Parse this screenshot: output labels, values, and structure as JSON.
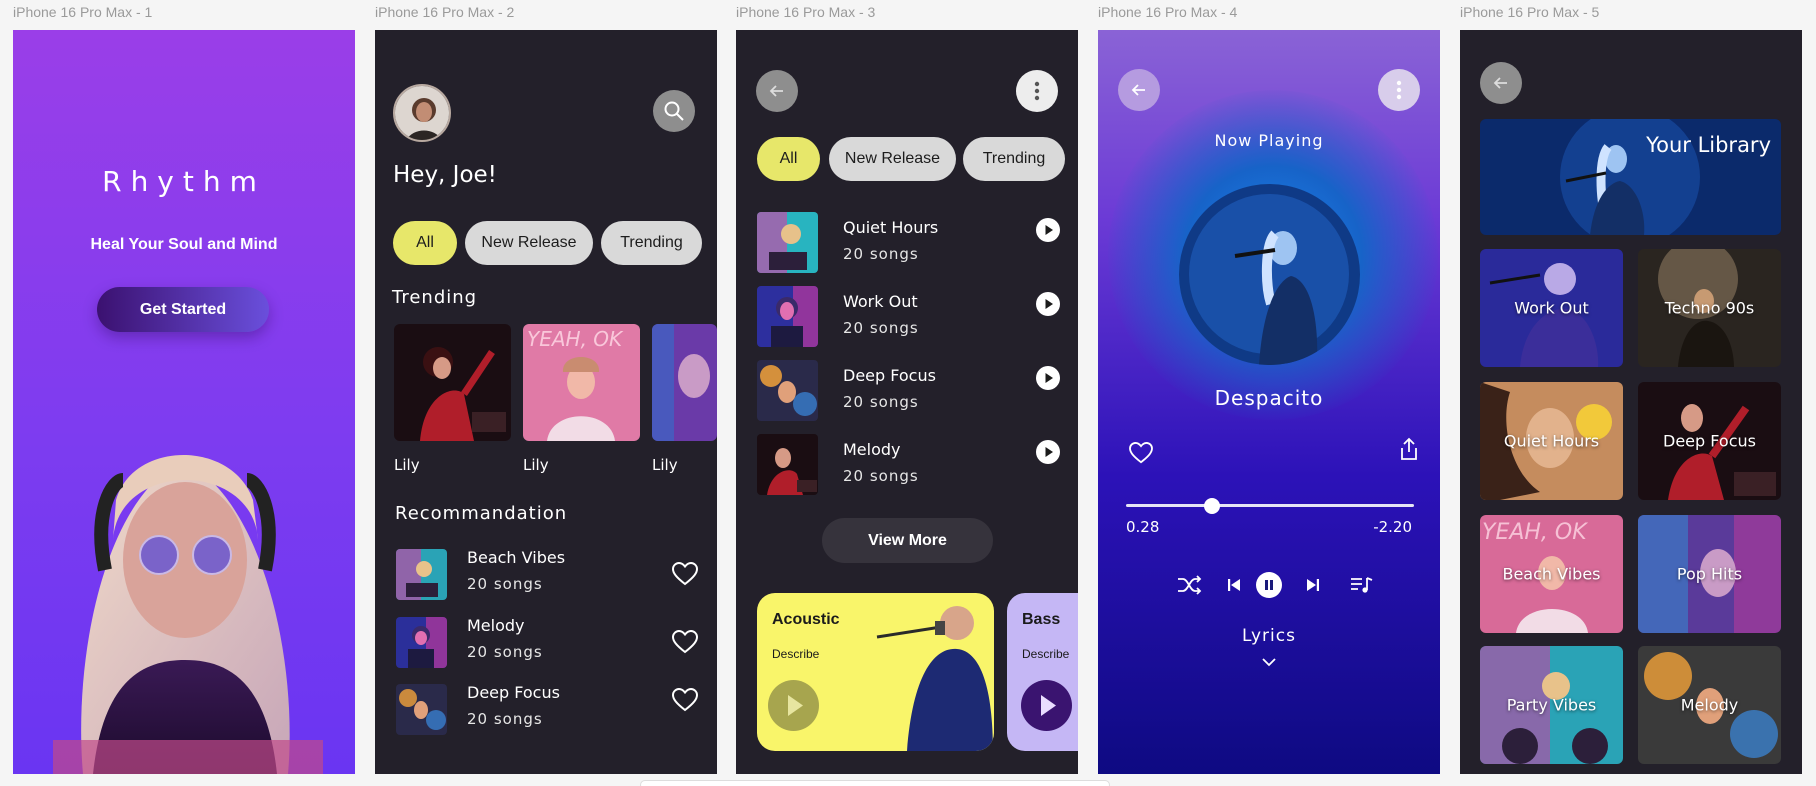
{
  "frames": {
    "f1": "iPhone 16 Pro Max - 1",
    "f2": "iPhone 16 Pro Max - 2",
    "f3": "iPhone 16 Pro Max - 3",
    "f4": "iPhone 16 Pro Max - 4",
    "f5": "iPhone 16 Pro Max - 5"
  },
  "splash": {
    "brand": "Rhythm",
    "tagline": "Heal Your Soul and Mind",
    "cta": "Get Started"
  },
  "home": {
    "greeting": "Hey, Joe!",
    "chips": [
      "All",
      "New Release",
      "Trending"
    ],
    "trending_title": "Trending",
    "trending": [
      {
        "name": "Lily"
      },
      {
        "name": "Lily"
      },
      {
        "name": "Lily"
      }
    ],
    "recommendation_title": "Recommandation",
    "recommendations": [
      {
        "title": "Beach Vibes",
        "sub": "20 songs"
      },
      {
        "title": "Melody",
        "sub": "20 songs"
      },
      {
        "title": "Deep Focus",
        "sub": "20 songs"
      }
    ]
  },
  "browse": {
    "chips": [
      "All",
      "New Release",
      "Trending"
    ],
    "playlists": [
      {
        "title": "Quiet Hours",
        "sub": "20 songs"
      },
      {
        "title": "Work Out",
        "sub": "20 songs"
      },
      {
        "title": "Deep Focus",
        "sub": "20 songs"
      },
      {
        "title": "Melody",
        "sub": "20 songs"
      }
    ],
    "view_more": "View More",
    "genres": [
      {
        "title": "Acoustic",
        "sub": "Describe",
        "color": "#f9f56a"
      },
      {
        "title": "Bass",
        "sub": "Describe",
        "color": "#c5b7f5"
      }
    ]
  },
  "player": {
    "now_playing": "Now Playing",
    "song": "Despacito",
    "elapsed": "0.28",
    "remaining": "-2.20",
    "progress": 0.3,
    "lyrics": "Lyrics"
  },
  "library": {
    "title": "Your Library",
    "tiles": [
      "Work Out",
      "Techno 90s",
      "Quiet Hours",
      "Deep Focus",
      "Beach Vibes",
      "Pop Hits",
      "Party Vibes",
      "Melody"
    ]
  },
  "colors": {
    "accent_chip": "#e7e76a",
    "dark_bg": "#23202a",
    "purple": "#8a3fe6"
  },
  "icons": [
    "search-icon",
    "back-arrow-icon",
    "more-vertical-icon",
    "heart-icon",
    "share-icon",
    "shuffle-icon",
    "previous-icon",
    "pause-icon",
    "next-icon",
    "queue-icon",
    "chevron-down-icon",
    "play-icon"
  ]
}
